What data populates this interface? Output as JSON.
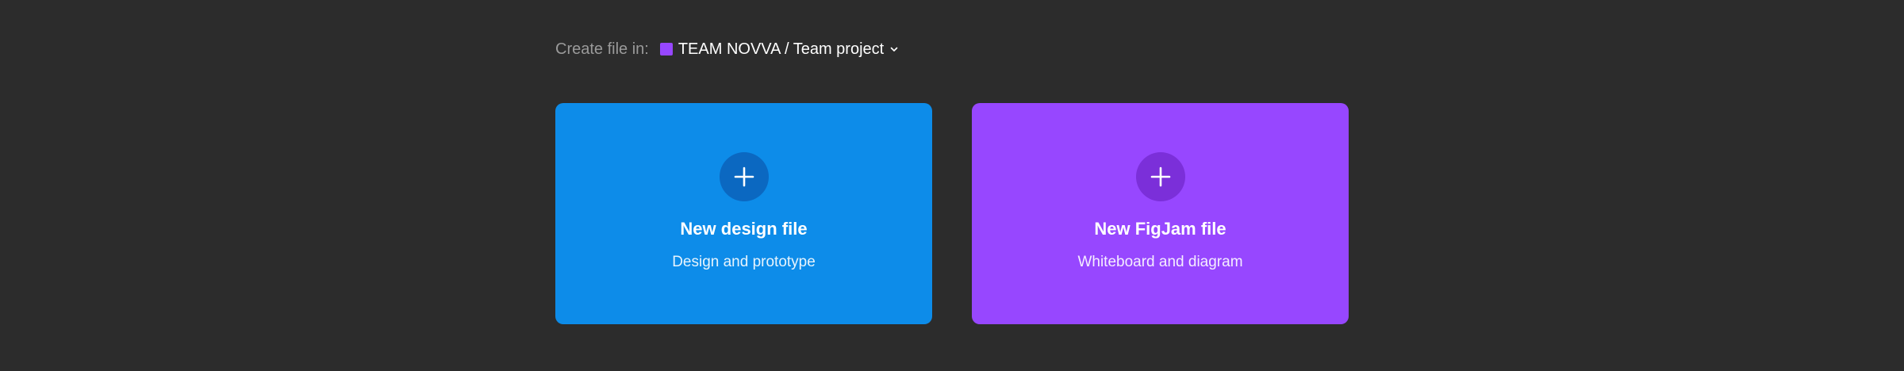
{
  "header": {
    "create_label": "Create file in:",
    "location": "TEAM NOVVA / Team project",
    "location_icon": "chevron-down-icon",
    "team_color": "#9747ff"
  },
  "cards": [
    {
      "title": "New design file",
      "subtitle": "Design and prototype",
      "icon": "plus-icon",
      "color": "#0d8ce9",
      "icon_bg": "#0b68c1"
    },
    {
      "title": "New FigJam file",
      "subtitle": "Whiteboard and diagram",
      "icon": "plus-icon",
      "color": "#9747ff",
      "icon_bg": "#7b2fd9"
    }
  ],
  "theme": {
    "background": "#2c2c2c",
    "label_color": "#9a9a9a",
    "text_color": "#ffffff"
  }
}
